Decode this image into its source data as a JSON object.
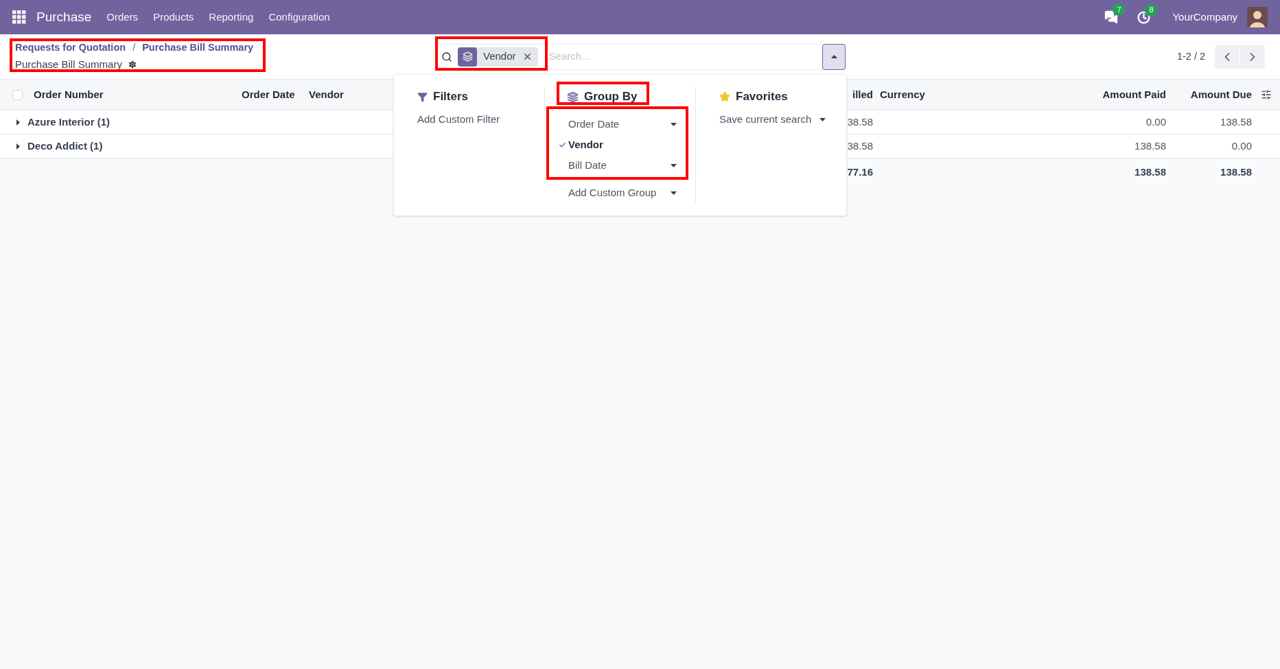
{
  "navbar": {
    "app": "Purchase",
    "menu": [
      "Orders",
      "Products",
      "Reporting",
      "Configuration"
    ],
    "messages_badge": "7",
    "activities_badge": "8",
    "company": "YourCompany"
  },
  "breadcrumb": {
    "links": [
      "Requests for Quotation",
      "Purchase Bill Summary"
    ],
    "separator": "/",
    "current": "Purchase Bill Summary"
  },
  "search": {
    "facet": "Vendor",
    "placeholder": "Search..."
  },
  "pager": "1-2 / 2",
  "dropdown": {
    "filters": {
      "title": "Filters",
      "items": [
        "Add Custom Filter"
      ]
    },
    "group_by": {
      "title": "Group By",
      "options": [
        {
          "label": "Order Date",
          "selected": false,
          "expandable": true
        },
        {
          "label": "Vendor",
          "selected": true,
          "expandable": false
        },
        {
          "label": "Bill Date",
          "selected": false,
          "expandable": true
        }
      ],
      "custom": "Add Custom Group"
    },
    "favorites": {
      "title": "Favorites",
      "items": [
        "Save current search"
      ]
    }
  },
  "table": {
    "select_all": {
      "checked": false
    },
    "columns_left": [
      "Order Number",
      "Order Date",
      "Vendor"
    ],
    "columns_right": [
      "illed",
      "Currency",
      "Amount Paid",
      "Amount Due"
    ],
    "rows": [
      {
        "group": "Azure Interior (1)",
        "billed": "38.58",
        "paid": "0.00",
        "due": "138.58"
      },
      {
        "group": "Deco Addict (1)",
        "billed": "38.58",
        "paid": "138.58",
        "due": "0.00"
      }
    ],
    "totals": {
      "billed": "77.16",
      "paid": "138.58",
      "due": "138.58"
    }
  }
}
